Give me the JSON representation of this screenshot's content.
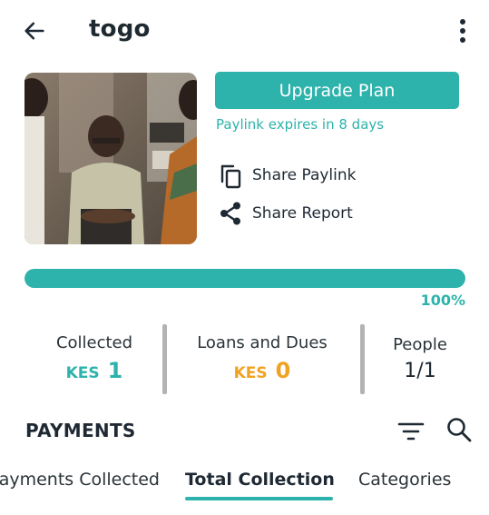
{
  "app_bar": {
    "title": "togo"
  },
  "icons": {
    "back": "arrow-left-icon",
    "more": "more-vertical-icon",
    "copy": "copy-icon",
    "share": "share-icon",
    "filter": "filter-icon",
    "search": "search-icon"
  },
  "actions": {
    "upgrade_label": "Upgrade Plan",
    "expiry_text": "Paylink expires in 8 days",
    "share_paylink": "Share Paylink",
    "share_report": "Share Report"
  },
  "progress": {
    "fraction": 1.0,
    "label": "100%"
  },
  "stats": {
    "collected": {
      "label": "Collected",
      "currency": "KES",
      "value": "1"
    },
    "loans": {
      "label": "Loans and Dues",
      "currency": "KES",
      "value": "0"
    },
    "people": {
      "label": "People",
      "value": "1/1"
    }
  },
  "payments": {
    "title": "PAYMENTS"
  },
  "tabs": [
    {
      "label": "Payments Collected"
    },
    {
      "label": "Total Collection"
    },
    {
      "label": "Categories"
    }
  ],
  "colors": {
    "accent": "#2db3ab",
    "orange": "#f0a223",
    "text": "#1f2933"
  }
}
